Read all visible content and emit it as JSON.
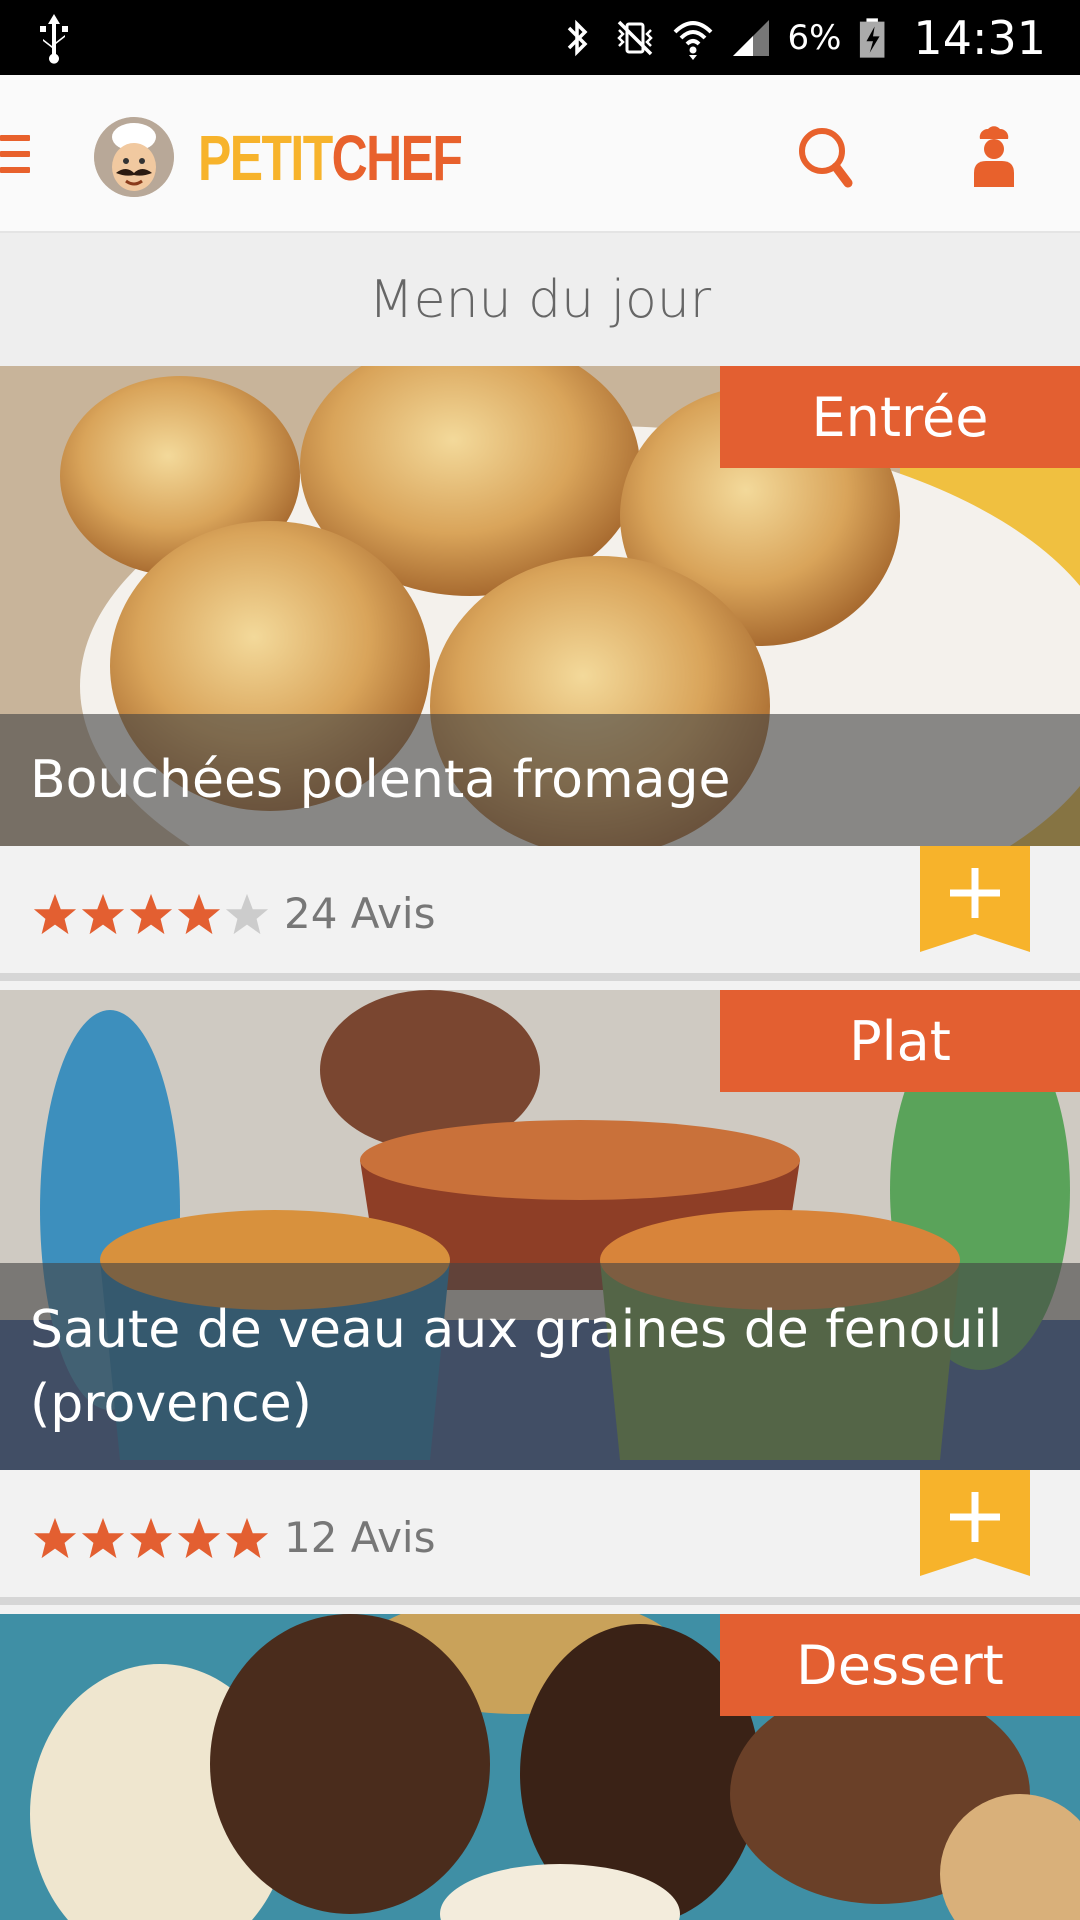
{
  "status_bar": {
    "battery": "6%",
    "time": "14:31"
  },
  "app_bar": {
    "logo_petit": "PETIT",
    "logo_chef": "CHEF"
  },
  "section_title": "Menu du jour",
  "colors": {
    "accent_orange": "#e35f31",
    "accent_yellow": "#f7b32b",
    "star_empty": "#cccccc"
  },
  "recipes": [
    {
      "category": "Entrée",
      "title": "Bouchées polenta fromage",
      "rating": 4,
      "reviews": "24 Avis"
    },
    {
      "category": "Plat",
      "title": "Saute de veau aux graines de fenouil (provence)",
      "rating": 5,
      "reviews": "12 Avis"
    },
    {
      "category": "Dessert"
    }
  ],
  "icons": {
    "menu": "hamburger-icon",
    "search": "search-icon",
    "user": "chef-user-icon",
    "add": "bookmark-plus-icon",
    "star": "star-icon"
  }
}
